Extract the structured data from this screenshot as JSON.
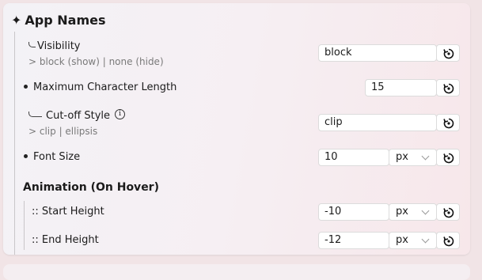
{
  "title": {
    "icon": "sparkle-icon",
    "text": "App Names",
    "glyph": "✦"
  },
  "rows": {
    "visibility": {
      "label": "Visibility",
      "hint": "> block (show) | none (hide)",
      "value": "block"
    },
    "max_len": {
      "label": "Maximum Character Length",
      "value": "15"
    },
    "cutoff": {
      "label": "Cut-off Style",
      "hint": "> clip | ellipsis",
      "value": "clip",
      "info": "i"
    },
    "font_size": {
      "label": "Font Size",
      "value": "10",
      "unit": "px"
    }
  },
  "animation": {
    "heading": "Animation (On Hover)",
    "start": {
      "label": ":: Start Height",
      "value": "-10",
      "unit": "px"
    },
    "end": {
      "label": ":: End Height",
      "value": "-12",
      "unit": "px"
    }
  }
}
